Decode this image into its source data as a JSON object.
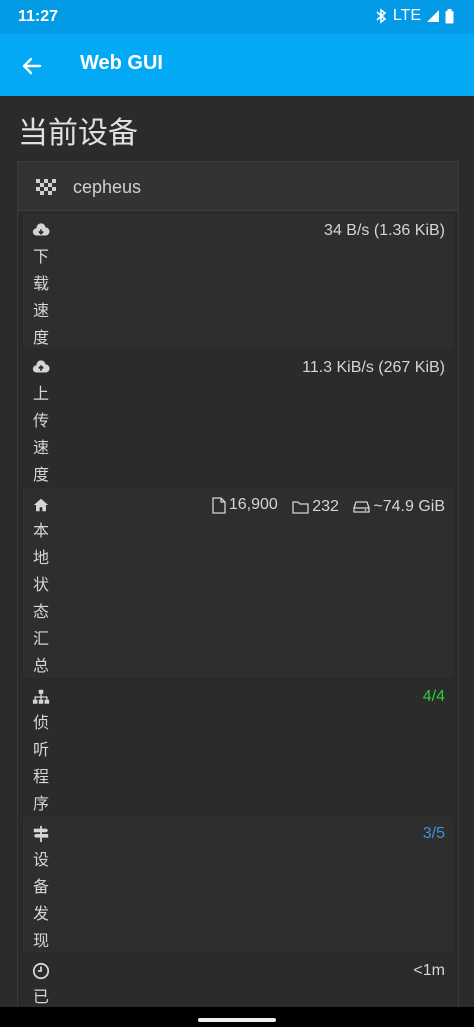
{
  "status_bar": {
    "time": "11:27",
    "network": "LTE"
  },
  "app_bar": {
    "title": "Web GUI"
  },
  "page": {
    "title": "当前设备"
  },
  "device": {
    "name": "cepheus"
  },
  "rows": {
    "download": {
      "label": "下载速度",
      "value": "34 B/s (1.36 KiB)",
      "icon": "cloud-download-icon"
    },
    "upload": {
      "label": "上传速度",
      "value": "11.3 KiB/s (267 KiB)",
      "icon": "cloud-upload-icon"
    },
    "local_state": {
      "label": "本地状态汇总",
      "files": "16,900",
      "folders": "232",
      "size": "~74.9 GiB",
      "icon": "home-icon"
    },
    "listeners": {
      "label": "侦听程序",
      "value": "4/4",
      "color": "#2ecc40",
      "icon": "sitemap-icon"
    },
    "discovery": {
      "label": "设备发现",
      "value": "3/5",
      "color": "#3a93e0",
      "icon": "signpost-icon"
    },
    "uptime": {
      "label": "已",
      "value": "<1m",
      "icon": "clock-icon"
    }
  }
}
